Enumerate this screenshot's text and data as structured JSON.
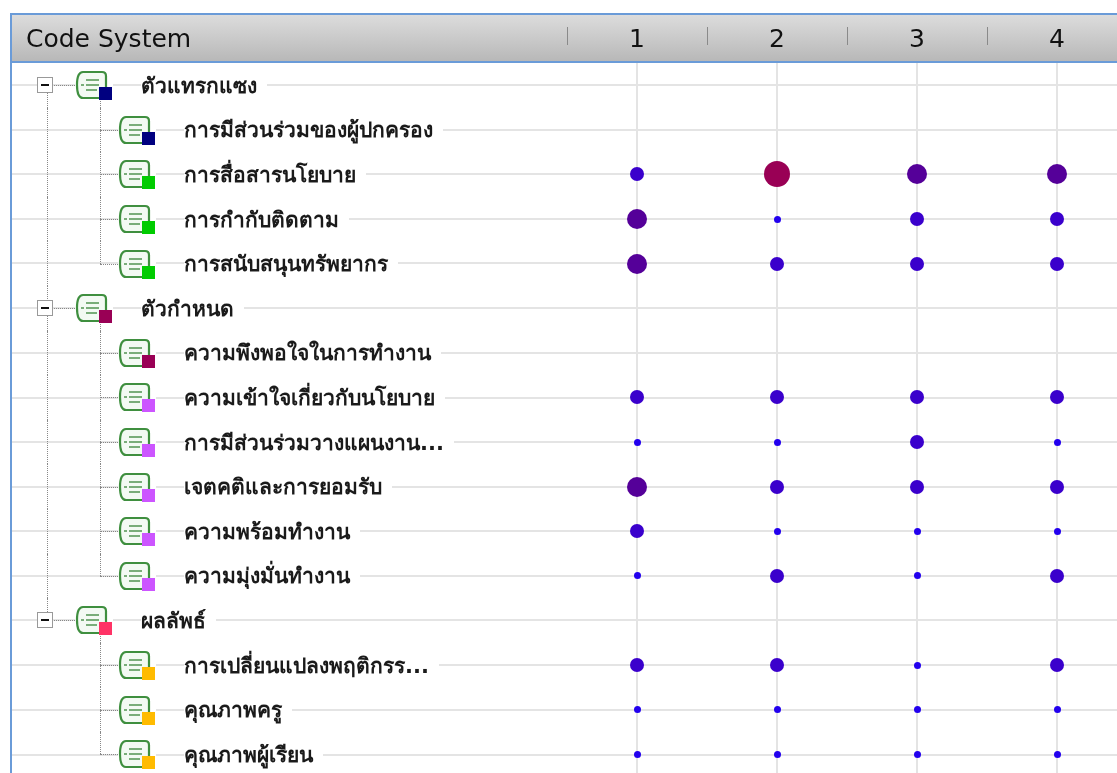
{
  "header": {
    "title": "Code System",
    "columns": [
      "1",
      "2",
      "3",
      "4"
    ]
  },
  "codes": [
    {
      "label": "ตัวแทรกแซง",
      "color": "#000080",
      "expanded": true,
      "children": [
        {
          "label": "การมีส่วนร่วมของผู้ปกครอง",
          "color": "#000080"
        },
        {
          "label": "การสื่อสารนโยบาย",
          "color": "#00cc00",
          "cells": [
            {
              "kind": "medium"
            },
            {
              "kind": "huge"
            },
            {
              "kind": "large"
            },
            {
              "kind": "large"
            }
          ]
        },
        {
          "label": "การกำกับติดตาม",
          "color": "#00cc00",
          "cells": [
            {
              "kind": "large"
            },
            {
              "kind": "tiny"
            },
            {
              "kind": "medium"
            },
            {
              "kind": "medium"
            }
          ]
        },
        {
          "label": "การสนับสนุนทรัพยากร",
          "color": "#00cc00",
          "cells": [
            {
              "kind": "large"
            },
            {
              "kind": "medium"
            },
            {
              "kind": "medium"
            },
            {
              "kind": "medium"
            }
          ]
        }
      ]
    },
    {
      "label": "ตัวกำหนด",
      "color": "#990055",
      "expanded": true,
      "children": [
        {
          "label": "ความพึงพอใจในการทำงาน",
          "color": "#990055"
        },
        {
          "label": "ความเข้าใจเกี่ยวกับนโยบาย",
          "color": "#cc55ff",
          "cells": [
            {
              "kind": "medium"
            },
            {
              "kind": "medium"
            },
            {
              "kind": "medium"
            },
            {
              "kind": "medium"
            }
          ]
        },
        {
          "label": "การมีส่วนร่วมวางแผนงาน...",
          "color": "#cc55ff",
          "cells": [
            {
              "kind": "tiny"
            },
            {
              "kind": "tiny"
            },
            {
              "kind": "medium"
            },
            {
              "kind": "tiny"
            }
          ]
        },
        {
          "label": "เจตคติและการยอมรับ",
          "color": "#cc55ff",
          "cells": [
            {
              "kind": "large"
            },
            {
              "kind": "medium"
            },
            {
              "kind": "medium"
            },
            {
              "kind": "medium"
            }
          ]
        },
        {
          "label": "ความพร้อมทำงาน",
          "color": "#cc55ff",
          "cells": [
            {
              "kind": "medium"
            },
            {
              "kind": "tiny"
            },
            {
              "kind": "tiny"
            },
            {
              "kind": "tiny"
            }
          ]
        },
        {
          "label": "ความมุ่งมั่นทำงาน",
          "color": "#cc55ff",
          "cells": [
            {
              "kind": "tiny"
            },
            {
              "kind": "medium"
            },
            {
              "kind": "tiny"
            },
            {
              "kind": "medium"
            }
          ]
        }
      ]
    },
    {
      "label": "ผลลัพธ์",
      "color": "#ff3366",
      "expanded": true,
      "children": [
        {
          "label": "การเปลี่ยนแปลงพฤติกรร...",
          "color": "#ffbb00",
          "cells": [
            {
              "kind": "medium"
            },
            {
              "kind": "medium"
            },
            {
              "kind": "tiny"
            },
            {
              "kind": "medium"
            }
          ]
        },
        {
          "label": "คุณภาพครู",
          "color": "#ffbb00",
          "cells": [
            {
              "kind": "tiny"
            },
            {
              "kind": "tiny"
            },
            {
              "kind": "tiny"
            },
            {
              "kind": "tiny"
            }
          ]
        },
        {
          "label": "คุณภาพผู้เรียน",
          "color": "#ffbb00",
          "cells": [
            {
              "kind": "tiny"
            },
            {
              "kind": "tiny"
            },
            {
              "kind": "tiny"
            },
            {
              "kind": "tiny"
            }
          ]
        }
      ]
    }
  ]
}
